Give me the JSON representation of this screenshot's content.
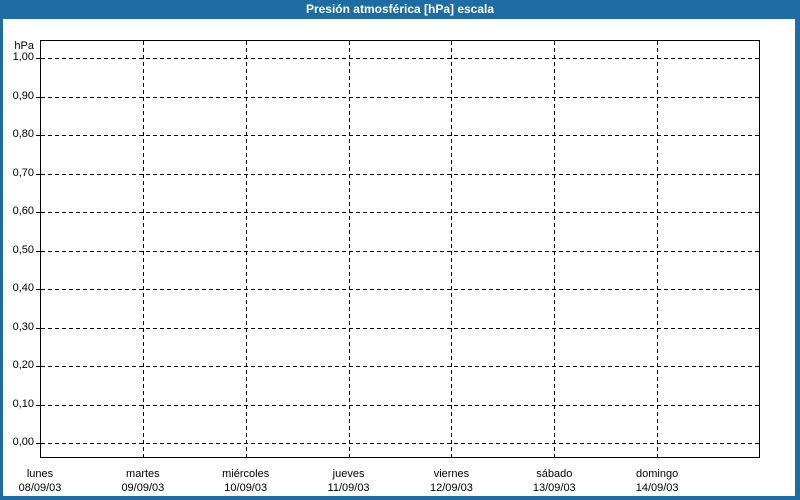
{
  "window": {
    "title": "Presión atmosférica [hPa] escala"
  },
  "colors": {
    "title_bar_bg": "#1E6CA4",
    "title_text": "#FFFFFF",
    "window_border": "#1E6CA4",
    "plot_bg": "#FFFFFF",
    "plot_border": "#000000",
    "gridline": "#000000",
    "label_text": "#000000"
  },
  "chart_data": {
    "type": "line",
    "title": "Presión atmosférica [hPa] escala",
    "grid": "dashed",
    "legend_position": "none",
    "y_axis": {
      "unit_label": "hPa",
      "min": 0,
      "max": 1,
      "step": 0.1,
      "tick_labels": [
        "1,00",
        "0,90",
        "0,80",
        "0,70",
        "0,60",
        "0,50",
        "0,40",
        "0,30",
        "0,20",
        "0,10",
        "0,00"
      ]
    },
    "x_axis": {
      "days": [
        {
          "name": "lunes",
          "date": "08/09/03"
        },
        {
          "name": "martes",
          "date": "09/09/03"
        },
        {
          "name": "miércoles",
          "date": "10/09/03"
        },
        {
          "name": "jueves",
          "date": "11/09/03"
        },
        {
          "name": "viernes",
          "date": "12/09/03"
        },
        {
          "name": "sábado",
          "date": "13/09/03"
        },
        {
          "name": "domingo",
          "date": "14/09/03"
        }
      ]
    },
    "series": []
  }
}
